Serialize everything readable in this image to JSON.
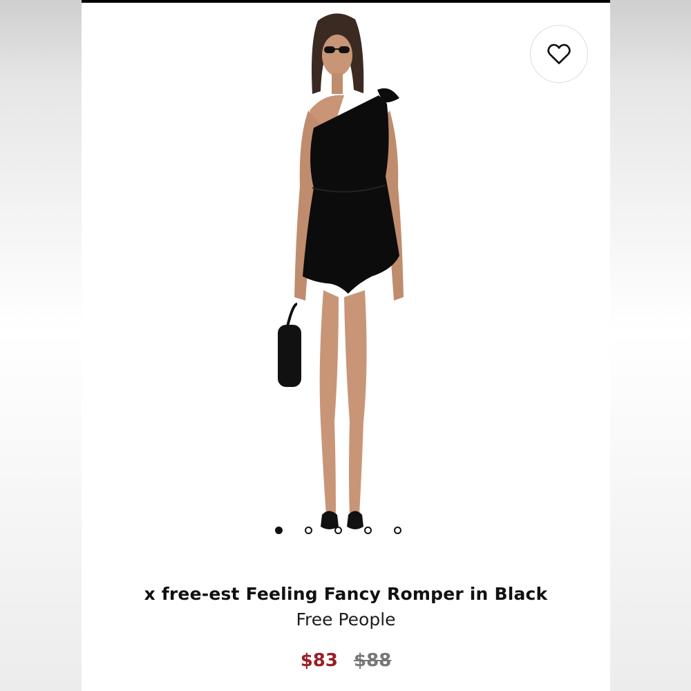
{
  "product": {
    "title": "x free-est Feeling Fancy Romper in Black",
    "brand": "Free People",
    "price_sale": "$83",
    "price_original": "$88"
  },
  "gallery": {
    "total_images": 5,
    "active_index": 0
  },
  "colors": {
    "sale_price": "#9b1c24",
    "original_price": "#777777",
    "romper": "#0c0c0c"
  },
  "icons": {
    "wishlist": "heart-icon"
  }
}
